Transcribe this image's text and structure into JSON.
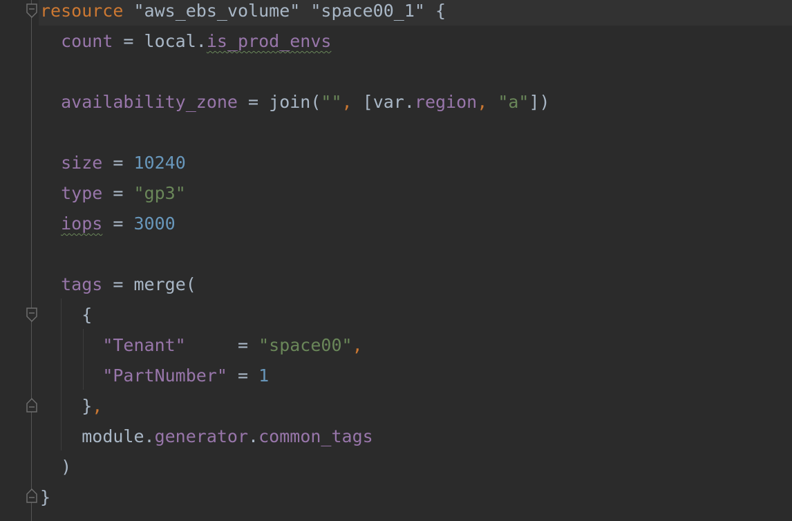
{
  "code": {
    "l1": {
      "kw": "resource",
      "s1": "\"aws_ebs_volume\"",
      "s2": "\"space00_1\"",
      "brace": "{"
    },
    "l2": {
      "key": "count",
      "eq": " = ",
      "obj": "local.",
      "attr": "is_prod_envs"
    },
    "l3": {
      "key": "availability_zone",
      "eq": " = ",
      "fn": "join(",
      "s1": "\"\"",
      "comma1": ",",
      "open": " [",
      "var": "var.",
      "attr": "region",
      "comma2": ",",
      "s2": " \"a\"",
      "close": "])"
    },
    "l4": {
      "key": "size",
      "eq": " = ",
      "num": "10240"
    },
    "l5": {
      "key": "type",
      "eq": " = ",
      "s": "\"gp3\""
    },
    "l6": {
      "key": "iops",
      "eq": " = ",
      "num": "3000"
    },
    "l7": {
      "key": "tags",
      "eq": " = ",
      "fn": "merge("
    },
    "l8": {
      "brace": "{"
    },
    "l9": {
      "key": "\"Tenant\"",
      "eq": "     = ",
      "s": "\"space00\"",
      "comma": ","
    },
    "l10": {
      "key": "\"PartNumber\"",
      "eq": " = ",
      "num": "1"
    },
    "l11": {
      "brace": "}",
      "comma": ","
    },
    "l12": {
      "obj": "module.",
      "attr1": "generator",
      "dot": ".",
      "attr2": "common_tags"
    },
    "l13": {
      "paren": ")"
    },
    "l14": {
      "brace": "}"
    }
  },
  "colors": {
    "background": "#2b2b2b",
    "keyword": "#cc7832",
    "string": "#6a8759",
    "property": "#9876aa",
    "number": "#6897bb",
    "text": "#a9b7c6"
  }
}
